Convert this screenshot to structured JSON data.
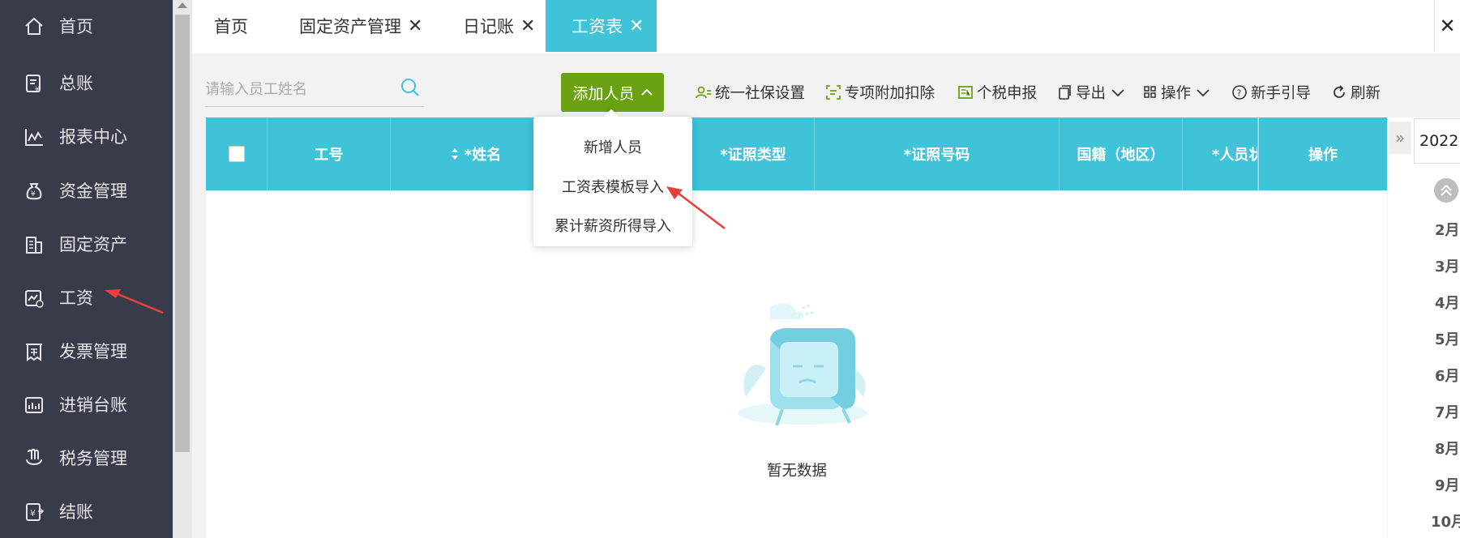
{
  "sidebar": {
    "items": [
      {
        "label": "首页",
        "icon": "home-icon"
      },
      {
        "label": "总账",
        "icon": "ledger-icon"
      },
      {
        "label": "报表中心",
        "icon": "chart-icon"
      },
      {
        "label": "资金管理",
        "icon": "money-bag-icon"
      },
      {
        "label": "固定资产",
        "icon": "building-icon"
      },
      {
        "label": "工资",
        "icon": "salary-icon"
      },
      {
        "label": "发票管理",
        "icon": "invoice-icon"
      },
      {
        "label": "进销台账",
        "icon": "inventory-icon"
      },
      {
        "label": "税务管理",
        "icon": "tax-icon"
      },
      {
        "label": "结账",
        "icon": "close-account-icon"
      }
    ]
  },
  "tabs": [
    {
      "label": "首页",
      "closable": false
    },
    {
      "label": "固定资产管理",
      "closable": true,
      "close": "✕"
    },
    {
      "label": "日记账",
      "closable": true,
      "close": "✕"
    },
    {
      "label": "工资表",
      "closable": true,
      "close": "✕",
      "active": true
    }
  ],
  "close_all": "✕",
  "search": {
    "placeholder": "请输入员工姓名"
  },
  "toolbar": {
    "add_label": "添加人员",
    "social_security": "统一社保设置",
    "deduction": "专项附加扣除",
    "tax_report": "个税申报",
    "export": "导出",
    "operate": "操作",
    "guide": "新手引导",
    "refresh": "刷新"
  },
  "dropdown": {
    "items": [
      "新增人员",
      "工资表模板导入",
      "累计薪资所得导入"
    ]
  },
  "table": {
    "headers": [
      "工号",
      "*姓名",
      "*证照类型",
      "*证照号码",
      "国籍（地区）",
      "*人员状",
      "操作"
    ],
    "empty_text": "暂无数据"
  },
  "right_panel": {
    "collapse": "»",
    "year": "2022.0",
    "months": [
      "2月",
      "3月",
      "4月",
      "5月",
      "6月",
      "7月",
      "8月",
      "9月",
      "10月"
    ]
  },
  "colors": {
    "accent": "#3ec3d9",
    "sidebar_bg": "#383b4a",
    "add_button": "#6aa112",
    "arrow": "#e8413a"
  }
}
